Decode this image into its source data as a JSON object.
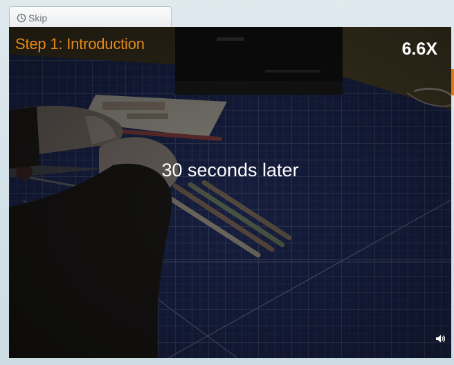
{
  "skip": {
    "label": "Skip",
    "icon": "clock-icon"
  },
  "video": {
    "step_title": "Step 1: Introduction",
    "speed": "6.6X",
    "caption": "30 seconds later",
    "volume_icon": "volume-icon"
  },
  "colors": {
    "accent": "#e68a16",
    "mat": "#1b2550",
    "grid": "#4a5670",
    "page_bg": "#d3e1e8"
  }
}
